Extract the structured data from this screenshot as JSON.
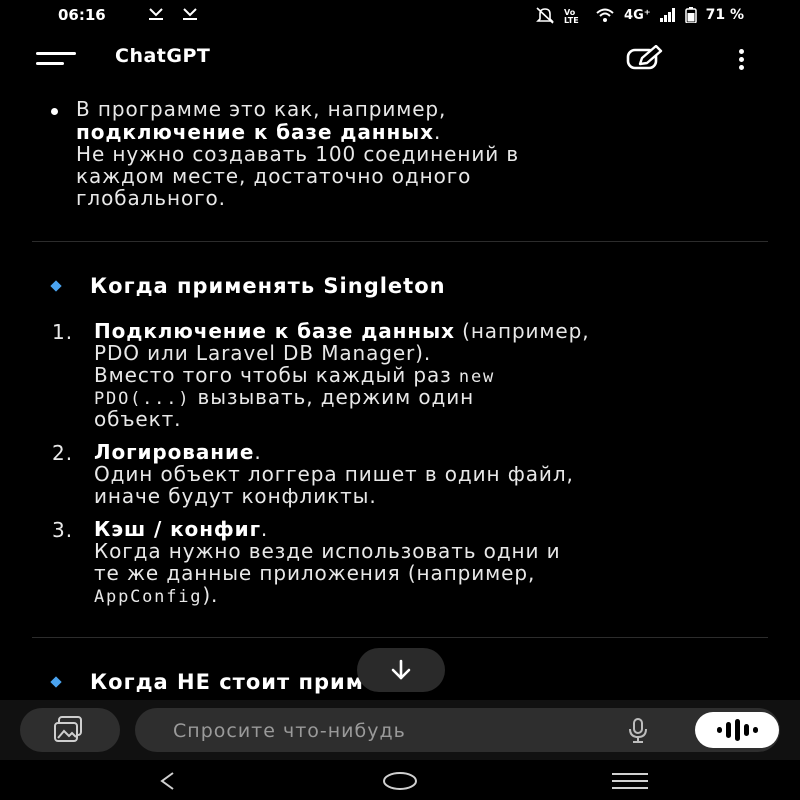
{
  "status_bar": {
    "time": "06:16",
    "network": "4G⁺",
    "battery_percent": "71 %",
    "icons": [
      "download-icon",
      "download-icon",
      "mute-icon",
      "volte-icon",
      "wifi-icon",
      "signal-icon",
      "battery-icon"
    ]
  },
  "app_bar": {
    "title": "ChatGPT",
    "icons": [
      "menu-icon",
      "new-chat-icon",
      "more-vertical-icon"
    ]
  },
  "content": {
    "intro_bullet": {
      "line1": "В программе это как, например,",
      "line2_bold": "подключение к базе данных",
      "line2_rest": ".",
      "line3": "Не нужно создавать 100 соединений в",
      "line4": "каждом месте, достаточно одного",
      "line5": "глобального."
    },
    "section1": {
      "heading": "Когда применять Singleton",
      "items": [
        {
          "number": "1.",
          "bold": "Подключение к базе данных",
          "rest": " (например,",
          "line2": "PDO или Laravel DB Manager).",
          "line3_text": "Вместо того чтобы каждый раз ",
          "line3_code": "new",
          "line4_code": "PDO(...)",
          "line4_text": " вызывать, держим один",
          "line5": "объект."
        },
        {
          "number": "2.",
          "bold": "Логирование",
          "rest": ".",
          "line2": "Один объект логгера пишет в один файл,",
          "line3": "иначе будут конфликты."
        },
        {
          "number": "3.",
          "bold": "Кэш / конфиг",
          "rest": ".",
          "line2": "Когда нужно везде использовать одни и",
          "line3": "те же данные приложения (например,",
          "line4_code": "AppConfig",
          "line4_text": ")."
        }
      ]
    },
    "section2": {
      "heading": "Когда НЕ стоит применять"
    }
  },
  "composer": {
    "placeholder": "Спросите что-нибудь",
    "icons": [
      "attach-icon",
      "microphone-icon",
      "voice-mode-icon"
    ]
  },
  "colors": {
    "background": "#000000",
    "text": "#e8e8e8",
    "accent_diamond": "#4aa3f0",
    "pill": "#2e2e2e"
  }
}
